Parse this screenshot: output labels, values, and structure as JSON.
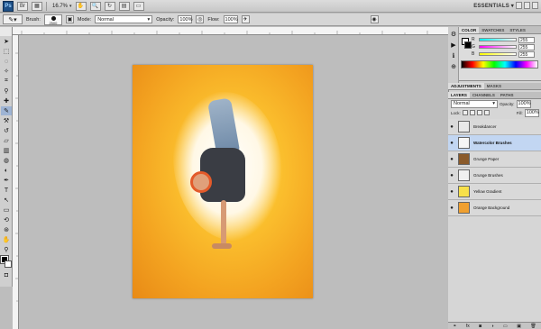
{
  "appbar": {
    "logo": "Ps",
    "zoom": "16.7%",
    "workspace": "ESSENTIALS",
    "workspace_arrow": "▾"
  },
  "options": {
    "brush_label": "Brush:",
    "brush_size": "2500",
    "mode_label": "Mode:",
    "mode_value": "Normal",
    "opacity_label": "Opacity:",
    "opacity_value": "100%",
    "flow_label": "Flow:",
    "flow_value": "100%"
  },
  "color_panel": {
    "tabs": [
      "COLOR",
      "SWATCHES",
      "STYLES"
    ],
    "channels": [
      {
        "label": "R",
        "value": "255"
      },
      {
        "label": "G",
        "value": "255"
      },
      {
        "label": "B",
        "value": "255"
      }
    ]
  },
  "adjust_panel": {
    "tabs": [
      "ADJUSTMENTS",
      "MASKS"
    ]
  },
  "layers_panel": {
    "tabs": [
      "LAYERS",
      "CHANNELS",
      "PATHS"
    ],
    "blend": "Normal",
    "opacity_label": "Opacity:",
    "opacity_value": "100%",
    "lock_label": "Lock:",
    "fill_label": "Fill:",
    "fill_value": "100%",
    "layers": [
      {
        "name": "Breakdancer",
        "thumb": "#e8e8e8",
        "selected": false
      },
      {
        "name": "Watercolor Brushes",
        "thumb": "#f6f6f6",
        "selected": true
      },
      {
        "name": "Grunge Paper",
        "thumb": "#8a5a2a",
        "selected": false
      },
      {
        "name": "Grunge Brushes",
        "thumb": "#f0f0f0",
        "selected": false
      },
      {
        "name": "Yellow Gradient",
        "thumb": "#f7e04a",
        "selected": false
      },
      {
        "name": "Orange Background",
        "thumb": "#f0a030",
        "selected": false
      }
    ]
  }
}
